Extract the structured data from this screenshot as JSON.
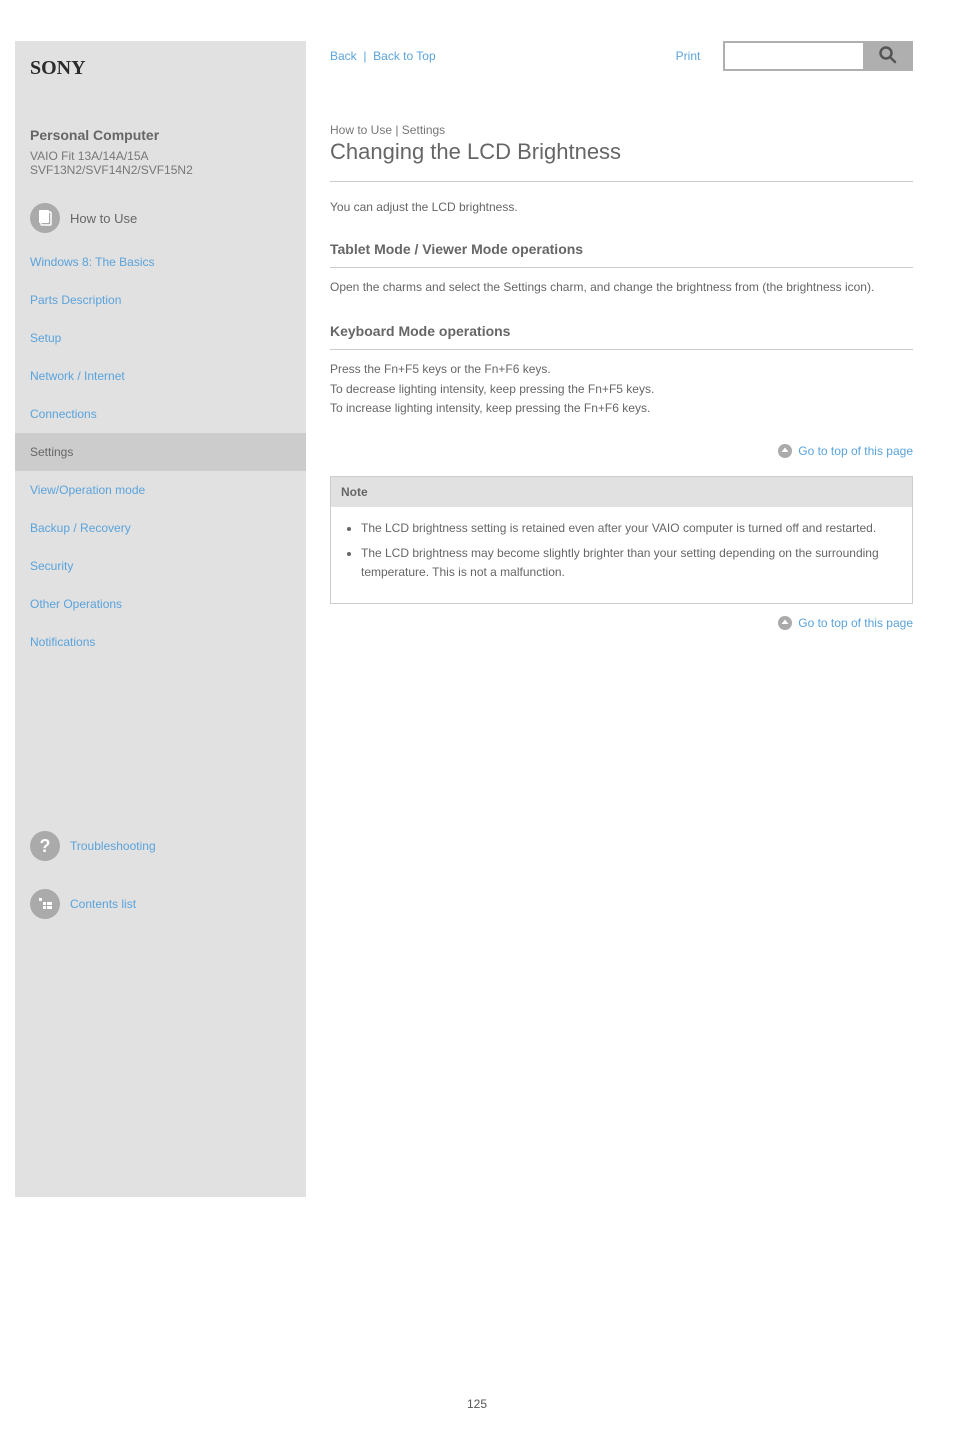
{
  "topbar": {
    "back_link": "Back",
    "top_link": "Back to Top",
    "print_link": "Print"
  },
  "search": {
    "placeholder": ""
  },
  "sidebar": {
    "product_title": "Personal Computer",
    "product_model": "VAIO Fit 13A/14A/15A SVF13N2/SVF14N2/SVF15N2",
    "how_to_use": {
      "title": "How to Use",
      "items": [
        "Windows 8: The Basics",
        "Parts Description",
        "Setup",
        "Network / Internet",
        "Connections",
        "Settings",
        "View/Operation mode",
        "Backup / Recovery",
        "Security",
        "Other Operations",
        "Notifications"
      ],
      "active_index": 5
    },
    "troubleshooting": "Troubleshooting",
    "contents_list": "Contents list"
  },
  "main": {
    "breadcrumb": "How to Use  |  Settings",
    "title": "Changing the LCD Brightness",
    "lead": "You can adjust the LCD brightness.",
    "sections": [
      {
        "heading": "Tablet Mode / Viewer Mode operations",
        "body": "Open the charms and select the Settings charm, and change the brightness from (the brightness icon)."
      },
      {
        "heading": "Keyboard Mode operations",
        "body": "Press the Fn+F5 keys or the Fn+F6 keys.\nTo decrease lighting intensity, keep pressing the Fn+F5 keys.\nTo increase lighting intensity, keep pressing the Fn+F6 keys."
      }
    ],
    "top_link_label": "Go to top of this page",
    "note": {
      "heading": "Note",
      "items": [
        "The LCD brightness setting is retained even after your VAIO computer is turned off and restarted.",
        "The LCD brightness may become slightly brighter than your setting depending on the surrounding temperature. This is not a malfunction."
      ]
    }
  },
  "page_number": "125",
  "icons": {
    "doc": "doc-icon",
    "question": "question-icon",
    "list": "list-icon",
    "search": "search-icon",
    "up": "up-arrow-icon"
  }
}
